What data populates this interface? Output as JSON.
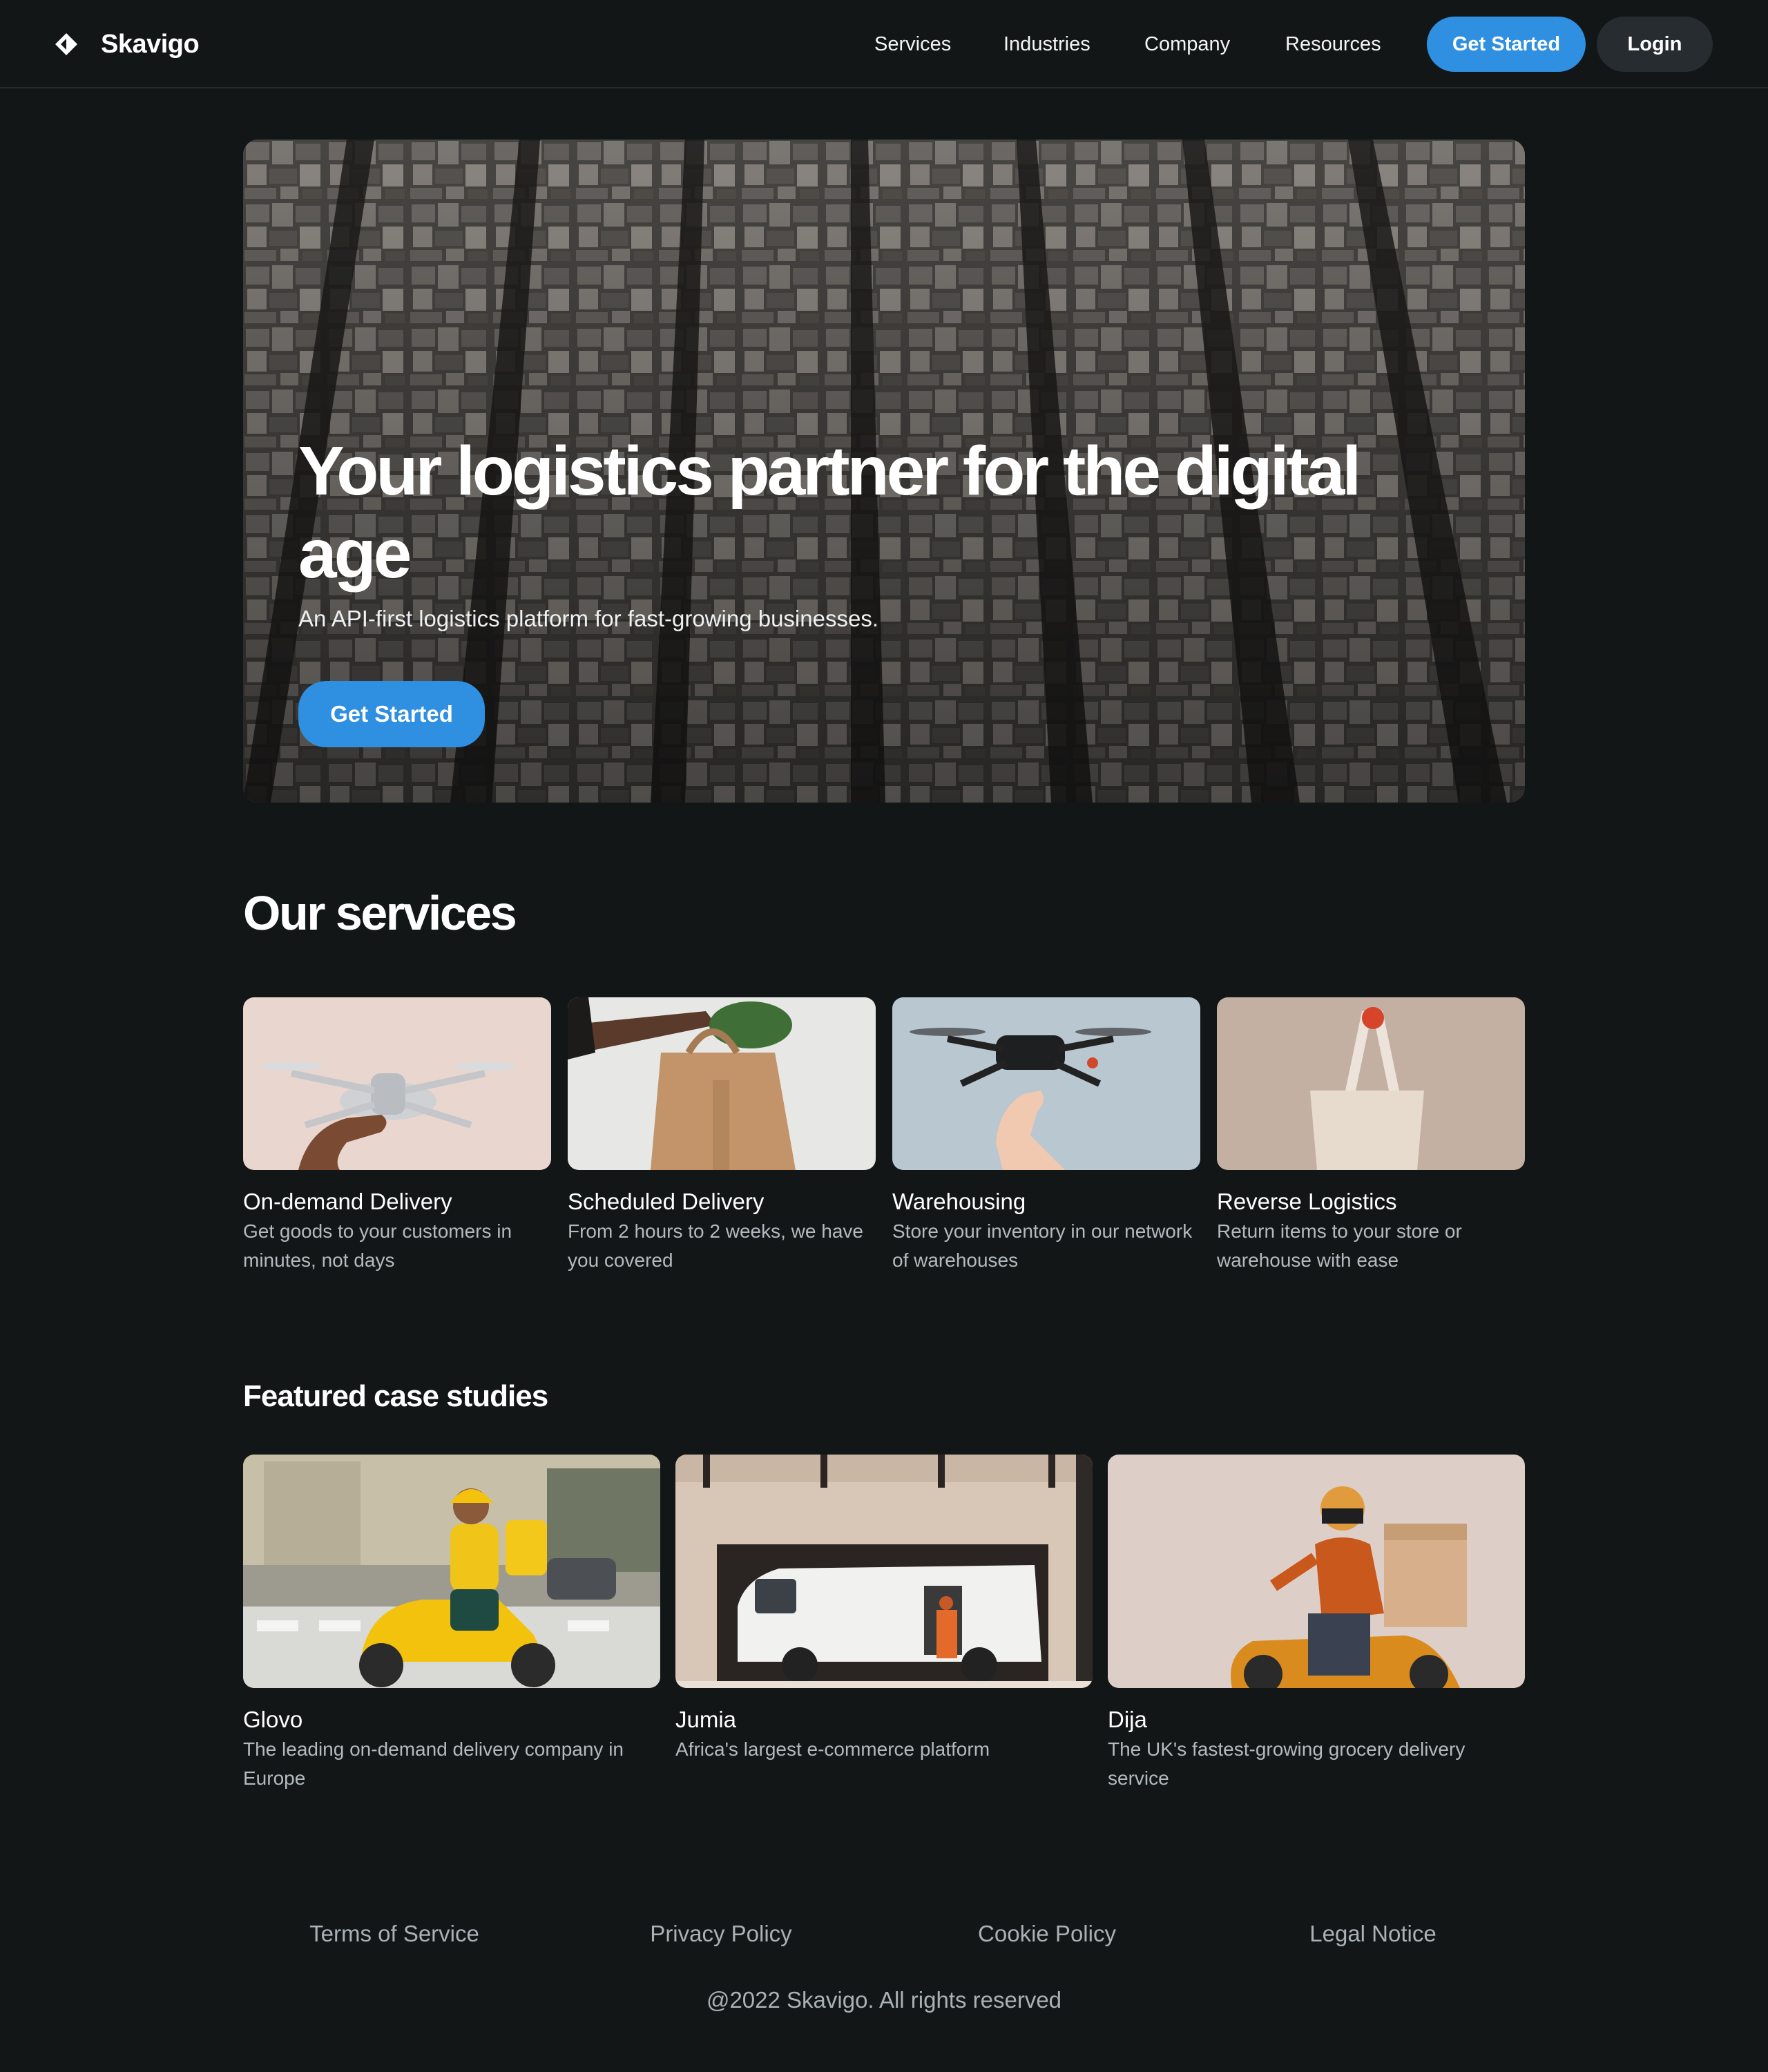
{
  "header": {
    "brand_name": "Skavigo",
    "nav": [
      "Services",
      "Industries",
      "Company",
      "Resources"
    ],
    "get_started": "Get Started",
    "login": "Login"
  },
  "hero": {
    "title": "Your logistics partner for the digital age",
    "subtitle": "An API-first logistics platform for fast-growing businesses.",
    "cta": "Get Started"
  },
  "services": {
    "title": "Our services",
    "items": [
      {
        "title": "On-demand Delivery",
        "description": "Get goods to your customers in minutes, not days"
      },
      {
        "title": "Scheduled Delivery",
        "description": "From 2 hours to 2 weeks, we have you covered"
      },
      {
        "title": "Warehousing",
        "description": "Store your inventory in our network of warehouses"
      },
      {
        "title": "Reverse Logistics",
        "description": "Return items to your store or warehouse with ease"
      }
    ]
  },
  "case_studies": {
    "title": "Featured case studies",
    "items": [
      {
        "title": "Glovo",
        "description": "The leading on-demand delivery company in Europe"
      },
      {
        "title": "Jumia",
        "description": "Africa's largest e-commerce platform"
      },
      {
        "title": "Dija",
        "description": "The UK's fastest-growing grocery delivery service"
      }
    ]
  },
  "footer": {
    "links": [
      "Terms of Service",
      "Privacy Policy",
      "Cookie Policy",
      "Legal Notice"
    ],
    "copyright": "@2022 Skavigo. All rights reserved"
  },
  "colors": {
    "background": "#121617",
    "accent": "#2f8fe0",
    "secondary_button": "#262c30",
    "muted_text": "#b3babd"
  }
}
